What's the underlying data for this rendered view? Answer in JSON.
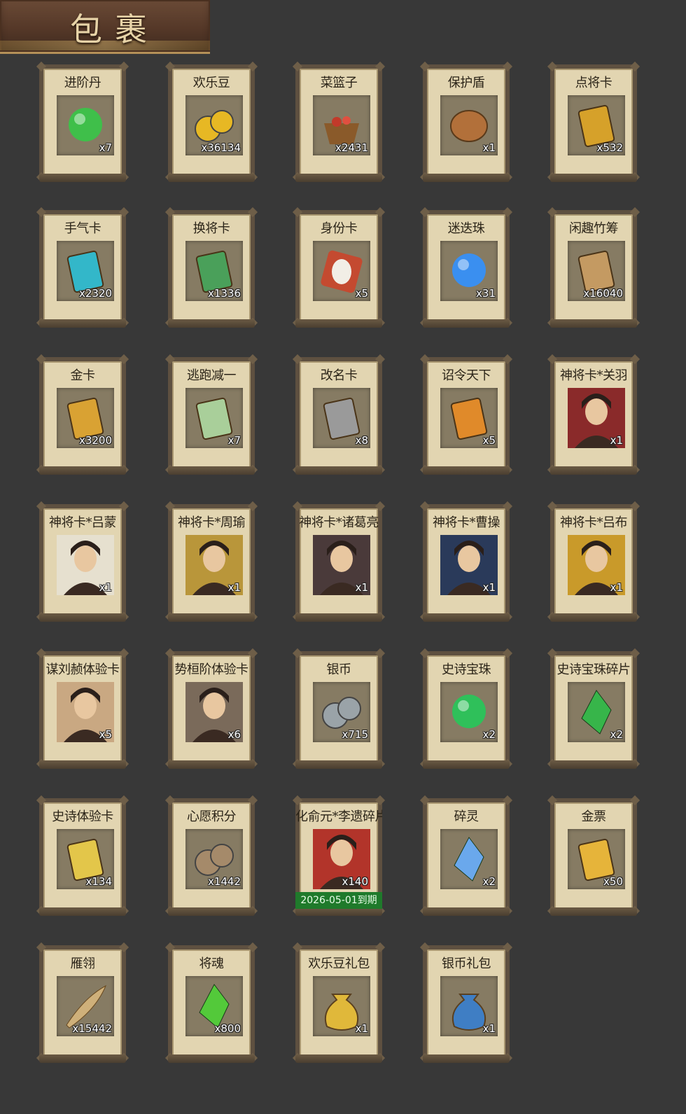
{
  "header": {
    "title": "包裹"
  },
  "items": [
    {
      "name": "进阶丹",
      "qty": "x7",
      "icon": "green-gem-icon",
      "color": "#3fbf4a"
    },
    {
      "name": "欢乐豆",
      "qty": "x36134",
      "icon": "gold-beans-icon",
      "color": "#e7b824"
    },
    {
      "name": "菜篮子",
      "qty": "x2431",
      "icon": "flower-basket-icon",
      "color": "#c23a2a"
    },
    {
      "name": "保护盾",
      "qty": "x1",
      "icon": "round-shield-icon",
      "color": "#b2703a"
    },
    {
      "name": "点将卡",
      "qty": "x532",
      "icon": "general-token-icon",
      "color": "#d6a12a"
    },
    {
      "name": "手气卡",
      "qty": "x2320",
      "icon": "luck-card-icon",
      "color": "#33b7c9"
    },
    {
      "name": "换将卡",
      "qty": "x1336",
      "icon": "swap-general-token-icon",
      "color": "#4aa05a"
    },
    {
      "name": "身份卡",
      "qty": "x5",
      "icon": "opera-mask-icon",
      "color": "#c44a30"
    },
    {
      "name": "迷迭珠",
      "qty": "x31",
      "icon": "blue-orb-icon",
      "color": "#3a8ff0"
    },
    {
      "name": "闲趣竹筹",
      "qty": "x16040",
      "icon": "bamboo-tally-icon",
      "color": "#c49a62"
    },
    {
      "name": "金卡",
      "qty": "x3200",
      "icon": "gold-card-icon",
      "color": "#d9a233"
    },
    {
      "name": "逃跑减一",
      "qty": "x7",
      "icon": "jade-tag-icon",
      "color": "#a9cf9a"
    },
    {
      "name": "改名卡",
      "qty": "x8",
      "icon": "name-tag-icon",
      "color": "#9a9a9a"
    },
    {
      "name": "诏令天下",
      "qty": "x5",
      "icon": "edict-scroll-icon",
      "color": "#e08a2a"
    },
    {
      "name": "神将卡*关羽",
      "qty": "x1",
      "icon": "guan-yu-portrait-icon",
      "color": "#8a2a2a"
    },
    {
      "name": "神将卡*吕蒙",
      "qty": "x1",
      "icon": "lv-meng-portrait-icon",
      "color": "#e6e0cf"
    },
    {
      "name": "神将卡*周瑜",
      "qty": "x1",
      "icon": "zhou-yu-portrait-icon",
      "color": "#b9963a"
    },
    {
      "name": "神将卡*诸葛亮",
      "qty": "x1",
      "icon": "zhuge-liang-portrait-icon",
      "color": "#4a3a3a"
    },
    {
      "name": "神将卡*曹操",
      "qty": "x1",
      "icon": "cao-cao-portrait-icon",
      "color": "#2a3a5a"
    },
    {
      "name": "神将卡*吕布",
      "qty": "x1",
      "icon": "lv-bu-portrait-icon",
      "color": "#c99a2a"
    },
    {
      "name": "谋刘赪体验卡",
      "qty": "x5",
      "icon": "liu-cheng-portrait-icon",
      "color": "#c9a882"
    },
    {
      "name": "势桓阶体验卡",
      "qty": "x6",
      "icon": "huan-jie-portrait-icon",
      "color": "#7a6a5a"
    },
    {
      "name": "银币",
      "qty": "x715",
      "icon": "silver-coins-icon",
      "color": "#9aa3a8"
    },
    {
      "name": "史诗宝珠",
      "qty": "x2",
      "icon": "green-orb-icon",
      "color": "#2fc05a"
    },
    {
      "name": "史诗宝珠碎片",
      "qty": "x2",
      "icon": "green-shard-icon",
      "color": "#37b54a"
    },
    {
      "name": "史诗体验卡",
      "qty": "x134",
      "icon": "epic-trial-card-icon",
      "color": "#e3c64a"
    },
    {
      "name": "心愿积分",
      "qty": "x1442",
      "icon": "heart-coin-icon",
      "color": "#a58a6a"
    },
    {
      "name": "化俞元*李遗碎片",
      "qty": "x140",
      "icon": "hero-fragment-portrait-icon",
      "color": "#b2342a",
      "expiry": "2026-05-01到期"
    },
    {
      "name": "碎灵",
      "qty": "x2",
      "icon": "crystal-shard-icon",
      "color": "#6aa8ec"
    },
    {
      "name": "金票",
      "qty": "x50",
      "icon": "gold-ticket-icon",
      "color": "#e6b43a"
    },
    {
      "name": "雁翎",
      "qty": "x15442",
      "icon": "feather-icon",
      "color": "#cfb07a"
    },
    {
      "name": "将魂",
      "qty": "x800",
      "icon": "soul-crystal-icon",
      "color": "#53c93a"
    },
    {
      "name": "欢乐豆礼包",
      "qty": "x1",
      "icon": "gold-pouch-icon",
      "color": "#e0b83a"
    },
    {
      "name": "银币礼包",
      "qty": "x1",
      "icon": "blue-pouch-icon",
      "color": "#3f7ec4"
    }
  ]
}
